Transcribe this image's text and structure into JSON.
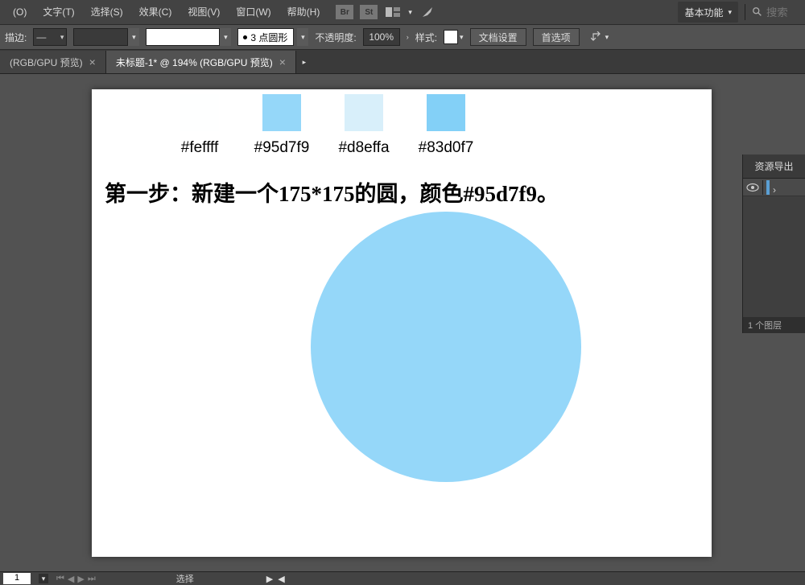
{
  "menu": {
    "items": [
      "(O)",
      "文字(T)",
      "选择(S)",
      "效果(C)",
      "视图(V)",
      "窗口(W)",
      "帮助(H)"
    ]
  },
  "topbar_icons": [
    "Br",
    "St"
  ],
  "workspace_switcher": "基本功能",
  "search": {
    "placeholder": "搜索"
  },
  "controlbar": {
    "stroke_label": "描边:",
    "stroke_dash": "—",
    "profile_label": "3 点圆形",
    "opacity_label": "不透明度:",
    "opacity_value": "100%",
    "style_label": "样式:",
    "doc_setup": "文档设置",
    "prefs": "首选项"
  },
  "tabs": [
    {
      "label": "(RGB/GPU 预览)",
      "active": false
    },
    {
      "label": "未标题-1* @ 194% (RGB/GPU 预览)",
      "active": true
    }
  ],
  "canvas": {
    "swatches": [
      {
        "hex": "#feffff",
        "color": "#feffff"
      },
      {
        "hex": "#95d7f9",
        "color": "#95d7f9"
      },
      {
        "hex": "#d8effa",
        "color": "#d8effa"
      },
      {
        "hex": "#83d0f7",
        "color": "#83d0f7"
      }
    ],
    "step_text": "第一步：新建一个175*175的圆，颜色#95d7f9。",
    "circle_color": "#95d7f9"
  },
  "rpanel": {
    "tab": "资源导出",
    "footer": "1 个图层"
  },
  "statusbar": {
    "page": "1",
    "tool": "选择"
  }
}
